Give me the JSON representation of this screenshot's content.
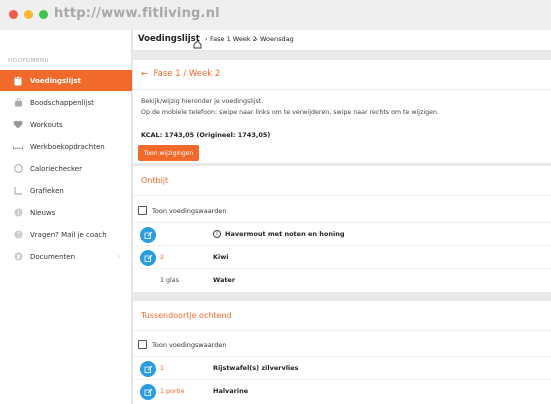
{
  "browser": {
    "url": "http://www.fitliving.nl"
  },
  "header": {
    "title": "Voedingslijst",
    "breadcrumb": [
      "Fase 1 Week 2",
      "Woensdag"
    ]
  },
  "sidebar": {
    "section_label": "HOOFDMENU",
    "items": [
      {
        "label": "Voedingslijst",
        "icon": "clipboard-icon"
      },
      {
        "label": "Boodschappenlijst",
        "icon": "shopping-bag-icon"
      },
      {
        "label": "Workouts",
        "icon": "heart-icon"
      },
      {
        "label": "Werkboekopdrachten",
        "icon": "book-icon"
      },
      {
        "label": "Caloriechecker",
        "icon": "circle-icon"
      },
      {
        "label": "Grafieken",
        "icon": "chart-icon"
      },
      {
        "label": "Nieuws",
        "icon": "info-icon"
      },
      {
        "label": "Vragen? Mail je coach",
        "icon": "question-icon"
      },
      {
        "label": "Documenten",
        "icon": "document-icon"
      }
    ],
    "active_index": 0
  },
  "week": {
    "heading": "Fase 1 / Week 2",
    "intro_line1": "Bekijk/wijzig hieronder je voedingslijst.",
    "intro_line2": "Op de mobiele telefoon: swipe naar links om te verwijderen, swipe naar rechts om te wijzigen.",
    "kcal": "KCAL: 1743,05 (Origineel: 1743,05)",
    "button": "Toon wijzigingen"
  },
  "meals": [
    {
      "title": "Ontbijt",
      "toggle_label": "Toon voedingswaarden",
      "items": [
        {
          "qty": "",
          "name": "Havermout met noten en honing",
          "has_info": true,
          "editable": true
        },
        {
          "qty": "2",
          "name": "Kiwi",
          "has_info": false,
          "editable": true
        },
        {
          "qty": "1 glas",
          "name": "Water",
          "has_info": false,
          "editable": false
        }
      ]
    },
    {
      "title": "Tussendoortje ochtend",
      "toggle_label": "Toon voedingswaarden",
      "items": [
        {
          "qty": "1",
          "name": "Rijstwafel(s) zilvervlies",
          "has_info": false,
          "editable": true
        },
        {
          "qty": "1 portie",
          "name": "Halvarine",
          "has_info": false,
          "editable": true
        }
      ]
    }
  ],
  "colors": {
    "accent": "#f26a2b",
    "edit_button": "#2a9de2"
  }
}
